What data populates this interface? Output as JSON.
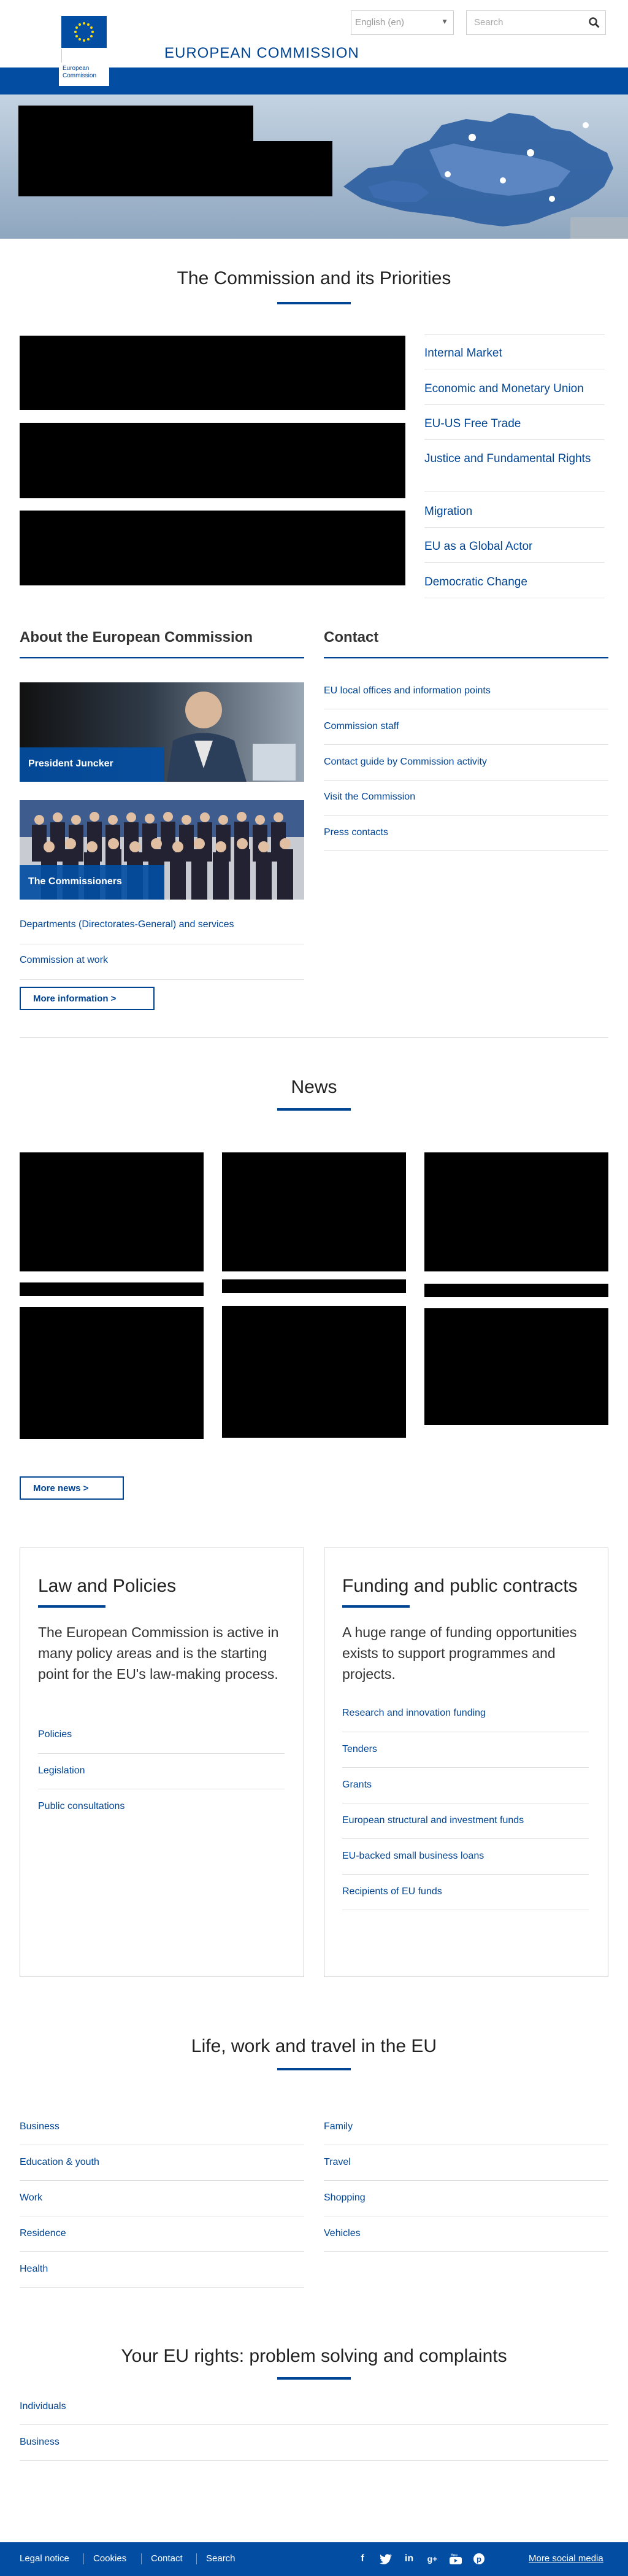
{
  "header": {
    "logo_text_line1": "European",
    "logo_text_line2": "Commission",
    "language": "English (en)",
    "search_placeholder": "Search",
    "site_title": "EUROPEAN COMMISSION"
  },
  "priorities": {
    "title": "The Commission and its Priorities",
    "links": [
      "Internal Market",
      "Economic and Monetary Union",
      "EU-US Free Trade",
      "Justice and Fundamental Rights",
      "Migration",
      "EU as a Global Actor",
      "Democratic Change"
    ]
  },
  "about": {
    "title": "About the European Commission",
    "juncker_label": "President Juncker",
    "commissioners_label": "The Commissioners",
    "links": [
      "Departments (Directorates-General) and services",
      "Commission at work"
    ],
    "more_button": "More information >"
  },
  "contact": {
    "title": "Contact",
    "links": [
      "EU local offices and information points",
      "Commission staff",
      "Contact guide by Commission activity",
      "Visit the Commission",
      "Press contacts"
    ]
  },
  "news": {
    "title": "News",
    "more_button": "More news >"
  },
  "law": {
    "title": "Law and Policies",
    "text": "The European Commission is active in many policy areas and is the starting point for the EU's law-making process.",
    "links": [
      "Policies",
      "Legislation",
      "Public consultations"
    ]
  },
  "funding": {
    "title": "Funding and public contracts",
    "text": "A huge range of funding opportunities exists to support programmes and projects.",
    "links": [
      "Research and innovation funding",
      "Tenders",
      "Grants",
      "European structural and investment funds",
      "EU-backed small business loans",
      "Recipients of EU funds"
    ]
  },
  "life": {
    "title": "Life, work and travel in the EU",
    "left_links": [
      "Business",
      "Education & youth",
      "Work",
      "Residence",
      "Health"
    ],
    "right_links": [
      "Family",
      "Travel",
      "Shopping",
      "Vehicles"
    ]
  },
  "rights": {
    "title": "Your EU rights: problem solving and complaints",
    "links": [
      "Individuals",
      "Business"
    ]
  },
  "footer": {
    "links": [
      "Legal notice",
      "Cookies",
      "Contact",
      "Search"
    ],
    "social_icons": [
      "facebook-icon",
      "twitter-icon",
      "linkedin-icon",
      "google-plus-icon",
      "youtube-icon",
      "pinterest-icon"
    ],
    "more_social": "More social media"
  },
  "colors": {
    "brand_blue": "#034ea2",
    "link_blue": "#004494"
  }
}
